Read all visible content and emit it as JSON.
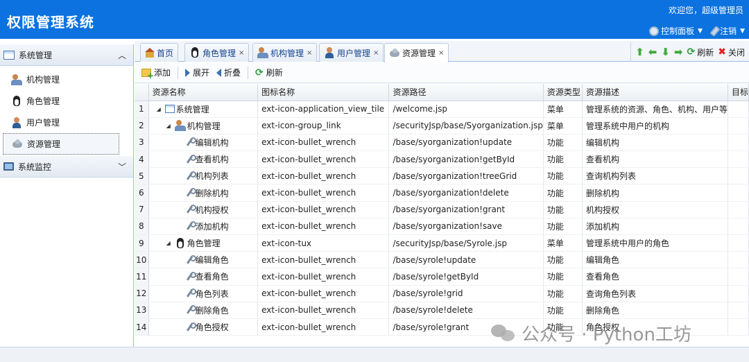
{
  "header": {
    "title": "权限管理系统",
    "welcome": "欢迎您，超级管理员",
    "menu": [
      {
        "label": "控制面板",
        "icon": "gear-icon"
      },
      {
        "label": "注销",
        "icon": "pen-icon"
      }
    ]
  },
  "sidebar": {
    "groups": [
      {
        "label": "系统管理",
        "icon": "window-icon",
        "expanded": true
      },
      {
        "label": "系统监控",
        "icon": "monitor-icon",
        "expanded": false
      }
    ],
    "items": [
      {
        "label": "机构管理",
        "icon": "group-icon"
      },
      {
        "label": "角色管理",
        "icon": "tux-icon"
      },
      {
        "label": "用户管理",
        "icon": "user-icon"
      },
      {
        "label": "资源管理",
        "icon": "cloud-icon",
        "active": true
      }
    ]
  },
  "tabs": [
    {
      "label": "首页",
      "closable": false
    },
    {
      "label": "角色管理",
      "closable": true,
      "close": "×"
    },
    {
      "label": "机构管理",
      "closable": true,
      "close": "×"
    },
    {
      "label": "用户管理",
      "closable": true,
      "close": "×"
    },
    {
      "label": "资源管理",
      "closable": true,
      "close": "×",
      "active": true
    }
  ],
  "tab_tools": {
    "up": "⬆",
    "left": "⬅",
    "down": "⬇",
    "right": "➡",
    "refresh_label": "刷新",
    "close_label": "关闭"
  },
  "toolbar": {
    "add_label": "添加",
    "expand_label": "展开",
    "collapse_label": "折叠",
    "refresh_label": "刷新"
  },
  "grid": {
    "columns": [
      "资源名称",
      "图标名称",
      "资源路径",
      "资源类型",
      "资源描述",
      "目标"
    ],
    "rows": [
      {
        "num": "1",
        "level": 0,
        "expander": "◢",
        "icon": "window-icon",
        "name": "系统管理",
        "icon_name": "ext-icon-application_view_tile",
        "path": "/welcome.jsp",
        "type": "菜单",
        "desc": "管理系统的资源、角色、机构、用户等"
      },
      {
        "num": "2",
        "level": 1,
        "expander": "◢",
        "icon": "group-icon",
        "name": "机构管理",
        "icon_name": "ext-icon-group_link",
        "path": "/securityJsp/base/Syorganization.jsp",
        "type": "菜单",
        "desc": "管理系统中用户的机构"
      },
      {
        "num": "3",
        "level": 2,
        "expander": "",
        "icon": "wrench-icon",
        "name": "编辑机构",
        "icon_name": "ext-icon-bullet_wrench",
        "path": "/base/syorganization!update",
        "type": "功能",
        "desc": "编辑机构"
      },
      {
        "num": "4",
        "level": 2,
        "expander": "",
        "icon": "wrench-icon",
        "name": "查看机构",
        "icon_name": "ext-icon-bullet_wrench",
        "path": "/base/syorganization!getById",
        "type": "功能",
        "desc": "查看机构"
      },
      {
        "num": "5",
        "level": 2,
        "expander": "",
        "icon": "wrench-icon",
        "name": "机构列表",
        "icon_name": "ext-icon-bullet_wrench",
        "path": "/base/syorganization!treeGrid",
        "type": "功能",
        "desc": "查询机构列表"
      },
      {
        "num": "6",
        "level": 2,
        "expander": "",
        "icon": "wrench-icon",
        "name": "删除机构",
        "icon_name": "ext-icon-bullet_wrench",
        "path": "/base/syorganization!delete",
        "type": "功能",
        "desc": "删除机构"
      },
      {
        "num": "7",
        "level": 2,
        "expander": "",
        "icon": "wrench-icon",
        "name": "机构授权",
        "icon_name": "ext-icon-bullet_wrench",
        "path": "/base/syorganization!grant",
        "type": "功能",
        "desc": "机构授权"
      },
      {
        "num": "8",
        "level": 2,
        "expander": "",
        "icon": "wrench-icon",
        "name": "添加机构",
        "icon_name": "ext-icon-bullet_wrench",
        "path": "/base/syorganization!save",
        "type": "功能",
        "desc": "添加机构"
      },
      {
        "num": "9",
        "level": 1,
        "expander": "◢",
        "icon": "tux-icon",
        "name": "角色管理",
        "icon_name": "ext-icon-tux",
        "path": "/securityJsp/base/Syrole.jsp",
        "type": "菜单",
        "desc": "管理系统中用户的角色"
      },
      {
        "num": "10",
        "level": 2,
        "expander": "",
        "icon": "wrench-icon",
        "name": "编辑角色",
        "icon_name": "ext-icon-bullet_wrench",
        "path": "/base/syrole!update",
        "type": "功能",
        "desc": "编辑角色"
      },
      {
        "num": "11",
        "level": 2,
        "expander": "",
        "icon": "wrench-icon",
        "name": "查看角色",
        "icon_name": "ext-icon-bullet_wrench",
        "path": "/base/syrole!getById",
        "type": "功能",
        "desc": "查看角色"
      },
      {
        "num": "12",
        "level": 2,
        "expander": "",
        "icon": "wrench-icon",
        "name": "角色列表",
        "icon_name": "ext-icon-bullet_wrench",
        "path": "/base/syrole!grid",
        "type": "功能",
        "desc": "查询角色列表"
      },
      {
        "num": "13",
        "level": 2,
        "expander": "",
        "icon": "wrench-icon",
        "name": "删除角色",
        "icon_name": "ext-icon-bullet_wrench",
        "path": "/base/syrole!delete",
        "type": "功能",
        "desc": "删除角色"
      },
      {
        "num": "14",
        "level": 2,
        "expander": "",
        "icon": "wrench-icon",
        "name": "角色授权",
        "icon_name": "ext-icon-bullet_wrench",
        "path": "/base/syrole!grant",
        "type": "功能",
        "desc": "角色授权"
      }
    ]
  },
  "watermark": {
    "text": "公众号 · Python工坊"
  }
}
